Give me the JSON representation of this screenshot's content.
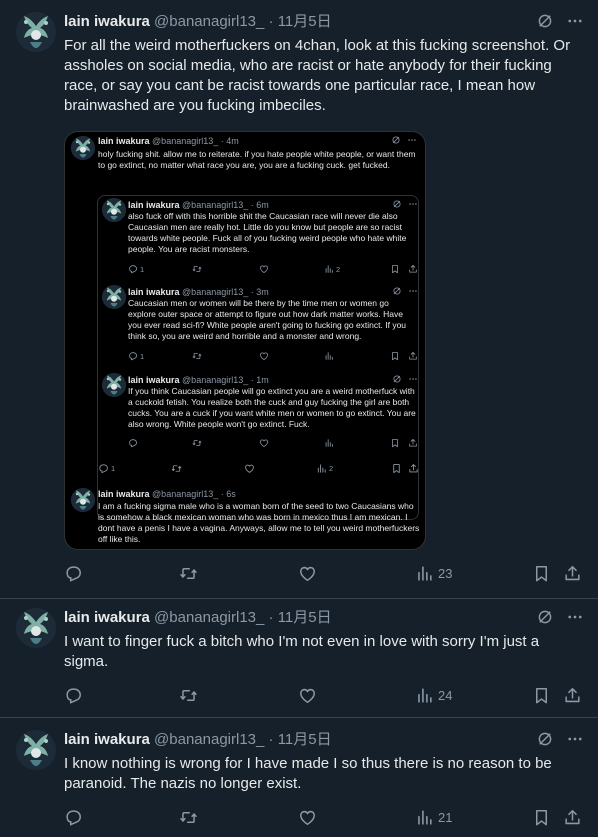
{
  "colors": {
    "background": "#15202b",
    "text": "#e7e9ea",
    "muted": "#8b98a5",
    "divider": "#38444d",
    "inner_bg": "#000000"
  },
  "tweets": [
    {
      "name": "lain iwakura",
      "handle": "@bananagirl13_",
      "sep": " · ",
      "date": "11月5日",
      "text": "For all the weird motherfuckers on 4chan, look at this fucking screenshot. Or assholes on social media, who are racist or hate anybody for their fucking race, or say you cant be racist towards one particular race, I mean how brainwashed are you fucking imbeciles.",
      "views": "23",
      "icons": [
        "grok-icon",
        "more-icon",
        "reply-icon",
        "retweet-icon",
        "like-icon",
        "views-icon",
        "bookmark-icon",
        "share-icon"
      ]
    },
    {
      "name": "lain iwakura",
      "handle": "@bananagirl13_",
      "sep": " · ",
      "date": "11月5日",
      "text": "I want to finger fuck a bitch who I'm not even in love with sorry I'm just a sigma.",
      "views": "24"
    },
    {
      "name": "lain iwakura",
      "handle": "@bananagirl13_",
      "sep": " · ",
      "date": "11月5日",
      "text": "I know nothing is wrong for I have made I so thus there is no reason to be paranoid. The nazis no longer exist.",
      "views": "21"
    }
  ],
  "screenshot": {
    "top": {
      "name": "lain iwakura",
      "handle": "@bananagirl13_",
      "sep": " · ",
      "time": "4m",
      "text": "holy fucking shit. allow me to reiterate. if you hate people white people, or want them to go extinct, no matter what race you are, you are a fucking cuck. get fucked.",
      "reply_count": "1",
      "views": "2"
    },
    "quoted": [
      {
        "name": "lain iwakura",
        "handle": "@bananagirl13_",
        "sep": " · ",
        "time": "6m",
        "text": "also fuck off with this horrible shit the Caucasian race will never die also Caucasian men are really hot. Little do you know but people are so racist towards white people. Fuck all of you fucking weird people who hate white people. You are racist monsters.",
        "reply_count": "1",
        "views": "2"
      },
      {
        "name": "lain iwakura",
        "handle": "@bananagirl13_",
        "sep": " · ",
        "time": "3m",
        "text": "Caucasian men or women will be there by the time men or women go explore outer space or attempt to figure out how dark matter works. Have you ever read sci-fi? White people aren't going to fucking go extinct. If you think so, you are weird and horrible and a monster and wrong.",
        "reply_count": "1",
        "views": ""
      },
      {
        "name": "lain iwakura",
        "handle": "@bananagirl13_",
        "sep": " · ",
        "time": "1m",
        "text": "If you think Caucasian people will go extinct you are a weird motherfuck with a cuckold fetish. You realize both the cuck and guy fucking the girl are both cucks. You are a cuck if you want white men or women to go extinct. You are also wrong. White people won't go extinct. Fuck.",
        "reply_count": "",
        "views": ""
      }
    ],
    "bottom": {
      "name": "lain iwakura",
      "handle": "@bananagirl13_",
      "sep": " · ",
      "time": "6s",
      "text": "I am a fucking sigma male who is a woman born of the seed to two Caucasians who is somehow a black mexican woman who was born in mexico thus I am mexican. I dont have a penis I have a vagina. Anyways, allow me to tell you weird motherfuckers off like this."
    }
  }
}
